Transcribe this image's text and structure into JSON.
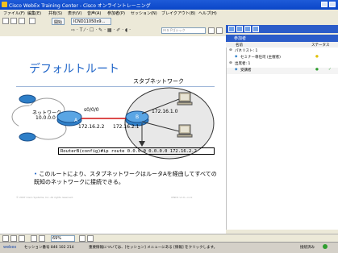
{
  "window": {
    "title": "Cisco WebEx Training Center - Cisco オンライントレーニング"
  },
  "menu": [
    "ファイル(F)",
    "編集(E)",
    "共有(S)",
    "表示(V)",
    "音声(A)",
    "参加者(P)",
    "セッション(N)",
    "ブレイクアウト(B)",
    "ヘルプ(H)"
  ],
  "toolbar": {
    "tab1": "開始",
    "tab2": "ICND11050x9..."
  },
  "editing": {
    "font_placeholder": "ＭＳ Pゴシック"
  },
  "slide": {
    "title": "デフォルトルート",
    "stub_network": "スタブネットワーク",
    "network_label": "ネットワーク",
    "network_addr": "10.0.0.0",
    "router_a": "A",
    "router_b": "B",
    "if_a": "s0/0/0",
    "ip_a": "172.16.2.2",
    "ip_b": "172.16.2.1",
    "ip_lan": "172.16.1.0",
    "command": "RouterB(config)#ip route 0.0.0.0 0.0.0.0 172.16.2.2",
    "bullet": "このルートにより、スタブネットワークはルータAを経由してすべての既知のネットワークに接続できる。",
    "footer_left": "© 2007 Cisco Systems, Inc. All rights reserved.",
    "footer_right": "ICND1 v1.0—x-xx"
  },
  "participants": {
    "header": "参加者",
    "col_name": "名前",
    "col_status": "ステータス",
    "rows": [
      {
        "label": "パネリスト: 1"
      },
      {
        "label": "セミナー専任司 (主催者)"
      },
      {
        "label": "出席者: 1"
      },
      {
        "label": "受講者"
      }
    ]
  },
  "bottom": {
    "zoom": "69%"
  },
  "status": {
    "session": "セッション番号 846 102 214",
    "info": "重要情報については、[セッション] メニューにある [情報] をクリックします。",
    "right": "接続済み"
  },
  "colors": {
    "accent": "#1E64C8",
    "titlebar": "#0A46C8"
  }
}
